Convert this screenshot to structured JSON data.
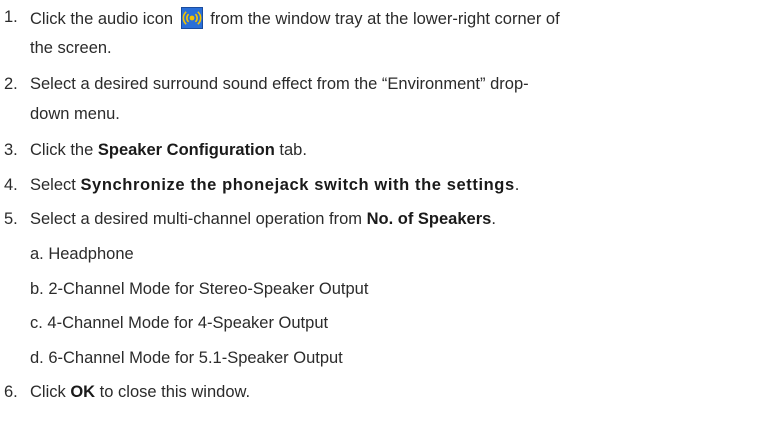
{
  "steps": [
    {
      "number": "1.",
      "text_before_icon": "Click the audio icon",
      "icon": "audio-tray-icon",
      "text_after_icon": "from the window tray at the lower-right corner of",
      "continuation": "the screen."
    },
    {
      "number": "2.",
      "text": "Select a desired surround sound effect from the “Environment” drop-",
      "continuation": "down menu."
    },
    {
      "number": "3.",
      "text_before": "Click the ",
      "bold": "Speaker Configuration",
      "text_after": " tab."
    },
    {
      "number": "4.",
      "text_before": "Select ",
      "bold": "Synchronize the phonejack switch with the settings",
      "text_after": "."
    },
    {
      "number": "5.",
      "text_before": "Select a desired multi-channel operation from ",
      "bold": "No. of Speakers",
      "text_after": ".",
      "sub_items": [
        "a. Headphone",
        "b. 2-Channel Mode for Stereo-Speaker Output",
        "c. 4-Channel Mode for 4-Speaker Output",
        "d. 6-Channel Mode for 5.1-Speaker Output"
      ]
    },
    {
      "number": "6.",
      "text_before": "Click ",
      "bold": "OK",
      "text_after": " to close this window."
    }
  ],
  "colors": {
    "text": "#2b2b2b",
    "icon_background": "#2a6fd8",
    "icon_symbol": "#f5c400"
  }
}
